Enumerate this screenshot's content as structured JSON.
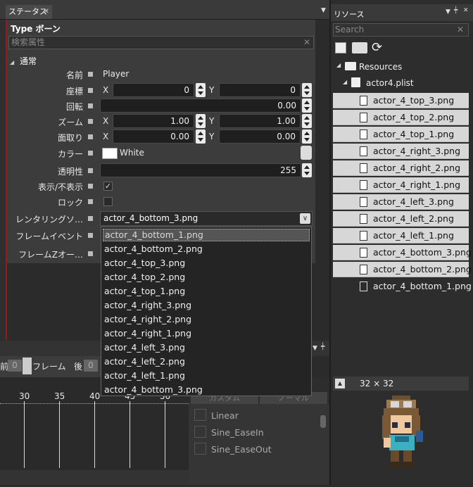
{
  "status_panel": {
    "tab_label": "ステータス",
    "type_label": "Type",
    "type_value": "ボーン",
    "search_placeholder": "検索属性",
    "section_title": "通常",
    "props": {
      "name": {
        "label": "名前",
        "value": "Player"
      },
      "position": {
        "label": "座標",
        "x_label": "X",
        "x": "0",
        "y_label": "Y",
        "y": "0"
      },
      "rotation": {
        "label": "回転",
        "value": "0.00"
      },
      "zoom": {
        "label": "ズーム",
        "x_label": "X",
        "x": "1.00",
        "y_label": "Y",
        "y": "1.00"
      },
      "skew": {
        "label": "面取り",
        "x_label": "X",
        "x": "0.00",
        "y_label": "Y",
        "y": "0.00"
      },
      "color": {
        "label": "カラー",
        "value": "White"
      },
      "opacity": {
        "label": "透明性",
        "value": "255"
      },
      "visible": {
        "label": "表示/不表示",
        "checked": true
      },
      "lock": {
        "label": "ロック",
        "checked": false
      },
      "render": {
        "label": "レンタリングソ…",
        "value": "actor_4_bottom_3.png"
      },
      "frame_event": {
        "label": "フレームイベント"
      },
      "frame_z": {
        "label": "フレームZオー…"
      }
    },
    "dropdown_options": [
      "actor_4_bottom_1.png",
      "actor_4_bottom_2.png",
      "actor_4_top_3.png",
      "actor_4_top_2.png",
      "actor_4_top_1.png",
      "actor_4_right_3.png",
      "actor_4_right_2.png",
      "actor_4_right_1.png",
      "actor_4_left_3.png",
      "actor_4_left_2.png",
      "actor_4_left_1.png",
      "actor_4_bottom_3.png"
    ]
  },
  "resources_panel": {
    "title": "リソース",
    "search_placeholder": "Search",
    "root": "Resources",
    "plist": "actor4.plist",
    "files": [
      {
        "name": "actor_4_top_3.png",
        "selected": true
      },
      {
        "name": "actor_4_top_2.png",
        "selected": true
      },
      {
        "name": "actor_4_top_1.png",
        "selected": true
      },
      {
        "name": "actor_4_right_3.png",
        "selected": true
      },
      {
        "name": "actor_4_right_2.png",
        "selected": true
      },
      {
        "name": "actor_4_right_1.png",
        "selected": true
      },
      {
        "name": "actor_4_left_3.png",
        "selected": true
      },
      {
        "name": "actor_4_left_2.png",
        "selected": true
      },
      {
        "name": "actor_4_left_1.png",
        "selected": true
      },
      {
        "name": "actor_4_bottom_3.png",
        "selected": true
      },
      {
        "name": "actor_4_bottom_2.png",
        "selected": true
      },
      {
        "name": "actor_4_bottom_1.png",
        "selected": false
      }
    ],
    "preview_size": "32 × 32"
  },
  "timeline": {
    "prev_label": "前",
    "prev_value": "0",
    "frame_label": "フレーム",
    "next_label": "後",
    "next_value": "0",
    "ruler_labels": [
      "30",
      "35",
      "40",
      "45",
      "50"
    ],
    "easing_header_left": "カスタム",
    "easing_header_right": "ノーマル",
    "easing_items": [
      "Linear",
      "Sine_EaseIn",
      "Sine_EaseOut"
    ]
  },
  "colors": {
    "selected_row": "#d7d7d7",
    "panel_bg": "#3c3c3c",
    "dark_bg": "#2b2b2b"
  }
}
